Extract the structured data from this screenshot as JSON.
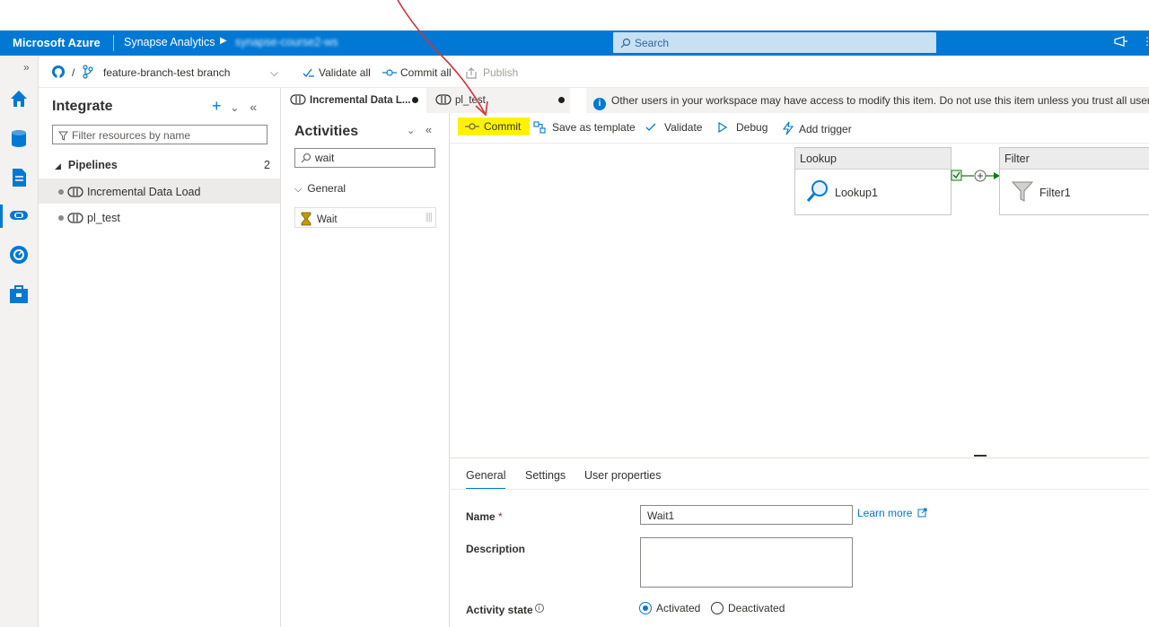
{
  "azure_bar": {
    "brand": "Microsoft Azure",
    "service": "Synapse Analytics",
    "workspace": "synapse-course2-ws",
    "search_placeholder": "Search"
  },
  "git_bar": {
    "repo_separator": "/",
    "branch": "feature-branch-test branch",
    "validate_all": "Validate all",
    "commit_all": "Commit all",
    "publish": "Publish"
  },
  "integrate": {
    "title": "Integrate",
    "filter_placeholder": "Filter resources by name",
    "group_label": "Pipelines",
    "group_count": "2",
    "items": [
      {
        "label": "Incremental Data Load"
      },
      {
        "label": "pl_test"
      }
    ]
  },
  "tabs": [
    {
      "label": "Incremental Data L..."
    },
    {
      "label": "pl_test"
    }
  ],
  "info_message": "Other users in your workspace may have access to modify this item. Do not use this item unless you trust all users with access to this workspace.",
  "activities": {
    "title": "Activities",
    "search_value": "wait",
    "category": "General",
    "items": [
      {
        "label": "Wait"
      }
    ]
  },
  "toolbar": {
    "commit": "Commit",
    "save_as_template": "Save as template",
    "validate": "Validate",
    "debug": "Debug",
    "add_trigger": "Add trigger"
  },
  "canvas": {
    "nodes": [
      {
        "type": "Lookup",
        "name": "Lookup1"
      },
      {
        "type": "Filter",
        "name": "Filter1"
      }
    ]
  },
  "properties": {
    "tabs": [
      "General",
      "Settings",
      "User properties"
    ],
    "name_label": "Name",
    "required_mark": "*",
    "name_value": "Wait1",
    "learn_more": "Learn more",
    "description_label": "Description",
    "activity_state_label": "Activity state",
    "activated": "Activated",
    "deactivated": "Deactivated",
    "selected_state": "Activated"
  },
  "colors": {
    "azure_blue": "#0078d4",
    "highlight": "#fff200",
    "annotation_arrow": "#d13438"
  }
}
